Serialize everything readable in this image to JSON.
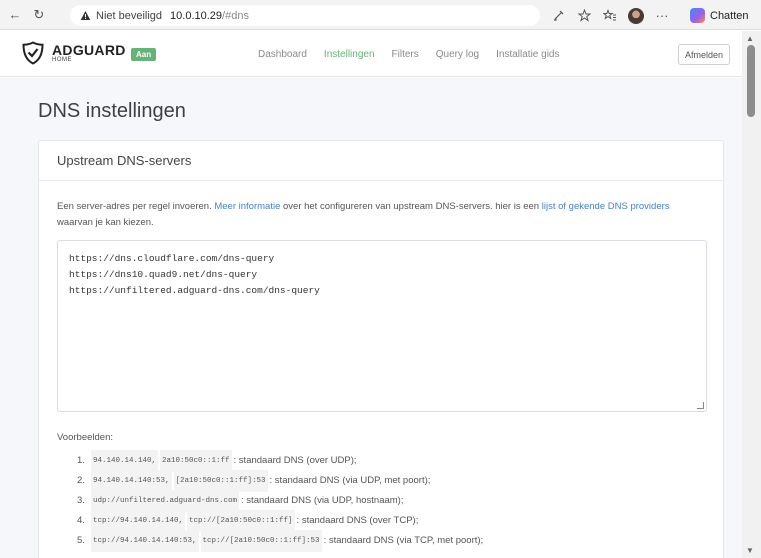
{
  "browser": {
    "back": "←",
    "reload": "↻",
    "insecure_label": "Niet beveiligd",
    "host": "10.0.10.29",
    "hash": "/#dns",
    "chat_label": "Chatten",
    "more": "···"
  },
  "app": {
    "brand": "ADGUARD",
    "brand_sub": "HOME",
    "status_badge": "Aan",
    "nav": [
      "Dashboard",
      "Instellingen",
      "Filters",
      "Query log",
      "Installatie gids"
    ],
    "active_nav_index": 1,
    "logout_label": "Afmelden",
    "accent_color": "#67b279"
  },
  "page": {
    "title": "DNS instellingen"
  },
  "upstream": {
    "card_title": "Upstream DNS-servers",
    "intro_1": "Een server-adres per regel invoeren. ",
    "intro_link_1": "Meer informatie",
    "intro_2": " over het configureren van upstream DNS-servers. hier is een ",
    "intro_link_2": "lijst of gekende DNS providers",
    "intro_3": " waarvan je kan kiezen.",
    "servers": [
      "https://dns.cloudflare.com/dns-query",
      "https://dns10.quad9.net/dns-query",
      "https://unfiltered.adguard-dns.com/dns-query"
    ],
    "examples_title": "Voorbeelden:",
    "examples": [
      {
        "num": "1.",
        "codes": [
          "94.140.14.140,",
          "2a10:50c0::1:ff"
        ],
        "desc": ": standaard DNS (over UDP);"
      },
      {
        "num": "2.",
        "codes": [
          "94.140.14.140:53,",
          "[2a10:50c0::1:ff]:53"
        ],
        "desc": ": standaard DNS (via UDP, met poort);"
      },
      {
        "num": "3.",
        "codes": [
          "udp://unfiltered.adguard-dns.com"
        ],
        "desc": ": standaard DNS (via UDP, hostnaam);"
      },
      {
        "num": "4.",
        "codes": [
          "tcp://94.140.14.140,",
          "tcp://[2a10:50c0::1:ff]"
        ],
        "desc": ": standaard DNS (over TCP);"
      },
      {
        "num": "5.",
        "codes": [
          "tcp://94.140.14.140:53,",
          "tcp://[2a10:50c0::1:ff]:53"
        ],
        "desc": ": standaard DNS (via TCP, met poort);"
      }
    ]
  }
}
